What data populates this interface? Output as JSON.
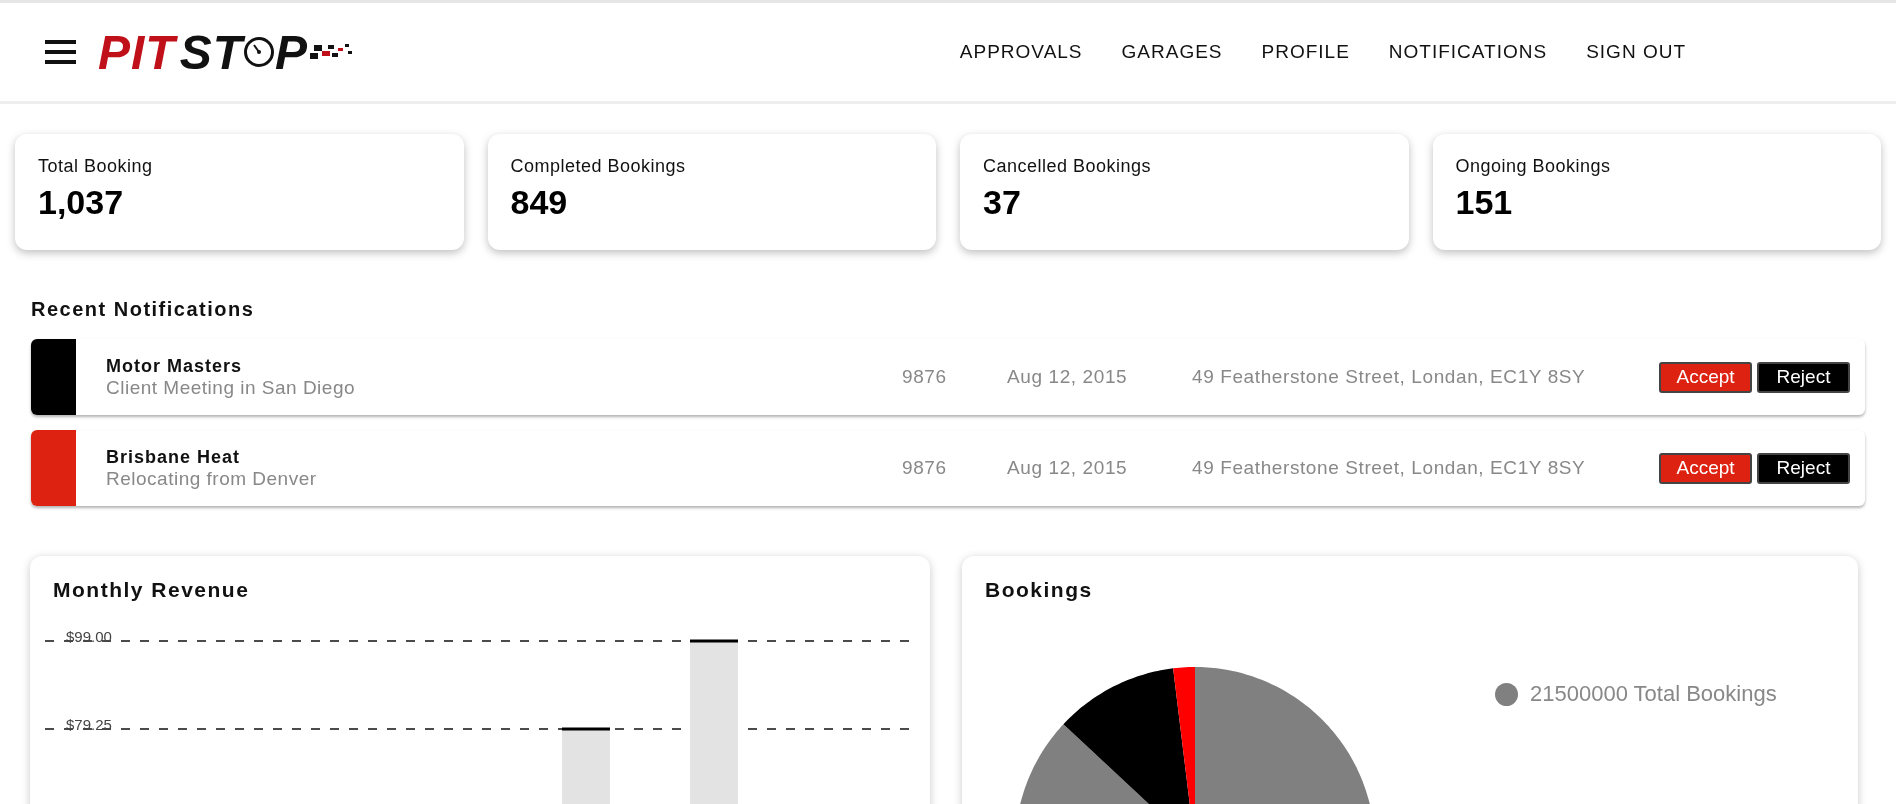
{
  "header": {
    "logo": {
      "red": "PIT",
      "dark": "ST",
      "tail": "P"
    },
    "nav": [
      "APPROVALS",
      "GARAGES",
      "PROFILE",
      "NOTIFICATIONS",
      "SIGN OUT"
    ]
  },
  "stats": [
    {
      "label": "Total Booking",
      "value": "1,037"
    },
    {
      "label": "Completed Bookings",
      "value": "849"
    },
    {
      "label": "Cancelled Bookings",
      "value": "37"
    },
    {
      "label": "Ongoing Bookings",
      "value": "151"
    }
  ],
  "notifications": {
    "title": "Recent Notifications",
    "items": [
      {
        "name": "Motor Masters",
        "subtitle": "Client Meeting in San Diego",
        "number": "9876",
        "date": "Aug 12, 2015",
        "address": "49 Featherstone Street, Londan, EC1Y 8SY",
        "color": "#000000",
        "accept": "Accept",
        "reject": "Reject"
      },
      {
        "name": "Brisbane Heat",
        "subtitle": "Relocating from Denver",
        "number": "9876",
        "date": "Aug 12, 2015",
        "address": "49 Featherstone Street, Londan, EC1Y 8SY",
        "color": "#dd2211",
        "accept": "Accept",
        "reject": "Reject"
      }
    ]
  },
  "revenue": {
    "title": "Monthly Revenue",
    "chart_data": {
      "type": "bar",
      "ylim": [
        0,
        99
      ],
      "values": [
        null,
        null,
        null,
        null,
        79.25,
        99,
        null
      ],
      "yticks": [
        {
          "value": 99,
          "label": "$99.00"
        },
        {
          "value": 79.25,
          "label": "$79.25"
        }
      ]
    }
  },
  "bookings": {
    "title": "Bookings",
    "legend": [
      {
        "label": "21500000 Total Bookings",
        "color": "#808080"
      }
    ]
  }
}
